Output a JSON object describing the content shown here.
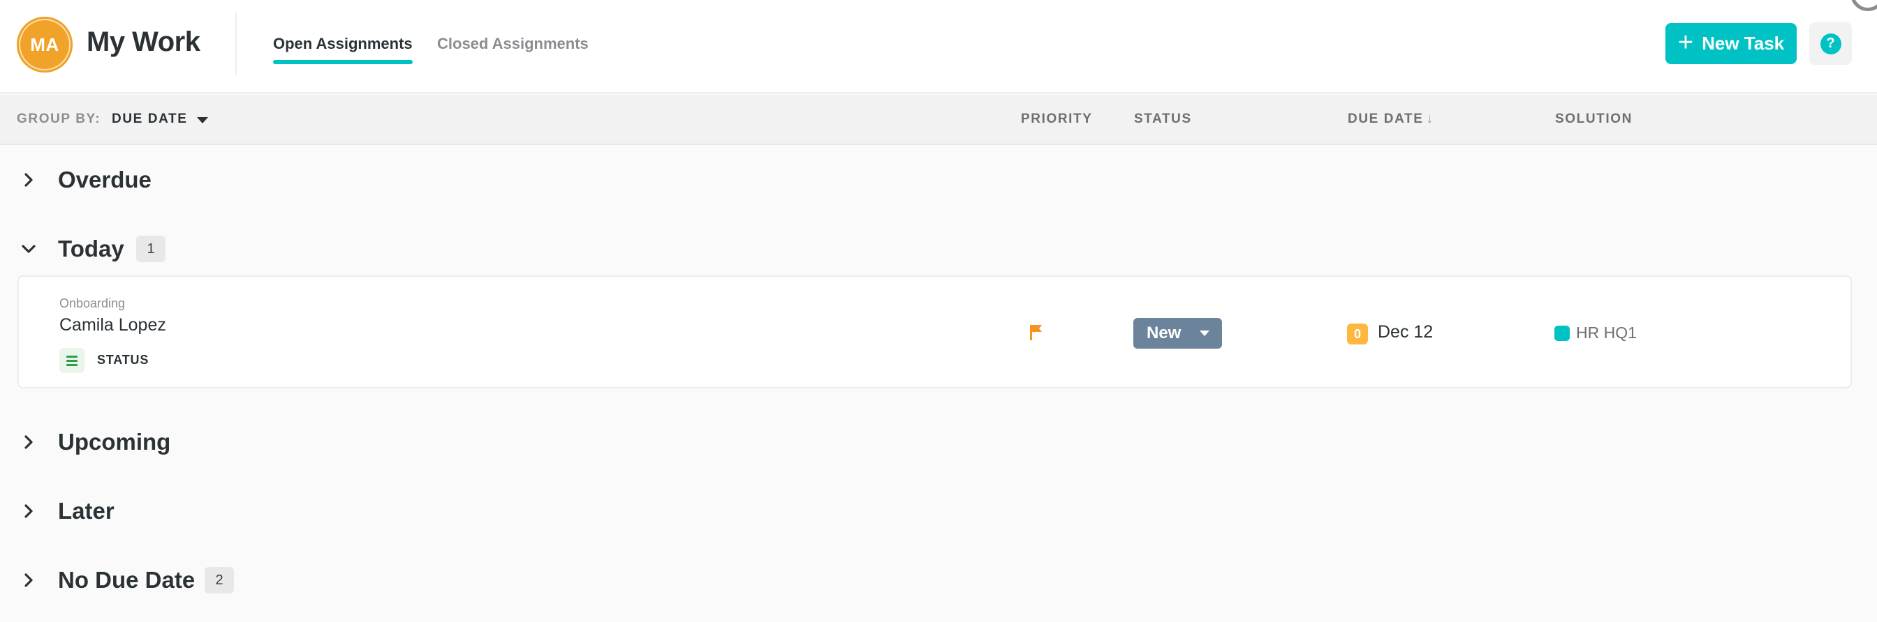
{
  "header": {
    "avatar_initials": "MA",
    "title": "My Work",
    "tabs": [
      {
        "label": "Open Assignments",
        "active": true
      },
      {
        "label": "Closed Assignments",
        "active": false
      }
    ],
    "new_task_label": "New Task",
    "help_label": "?"
  },
  "column_header": {
    "group_by_label": "GROUP BY:",
    "group_by_value": "DUE DATE",
    "columns": {
      "priority": "PRIORITY",
      "status": "STATUS",
      "due_date": "DUE DATE",
      "due_date_sort": "↓",
      "solution": "SOLUTION"
    }
  },
  "groups": [
    {
      "title": "Overdue",
      "expanded": false,
      "count": null
    },
    {
      "title": "Today",
      "expanded": true,
      "count": "1"
    },
    {
      "title": "Upcoming",
      "expanded": false,
      "count": null
    },
    {
      "title": "Later",
      "expanded": false,
      "count": null
    },
    {
      "title": "No Due Date",
      "expanded": false,
      "count": "2"
    }
  ],
  "today_tasks": [
    {
      "category": "Onboarding",
      "assignee": "Camila Lopez",
      "type_label": "STATUS",
      "priority": "flag",
      "status": "New",
      "due_badge": "0",
      "due_date": "Dec 12",
      "solution": "HR HQ1"
    }
  ],
  "colors": {
    "accent": "#00c2c4",
    "avatar": "#f0a229",
    "status_new": "#6b849b",
    "priority_flag": "#f7931e",
    "due_badge": "#ffb83f"
  }
}
